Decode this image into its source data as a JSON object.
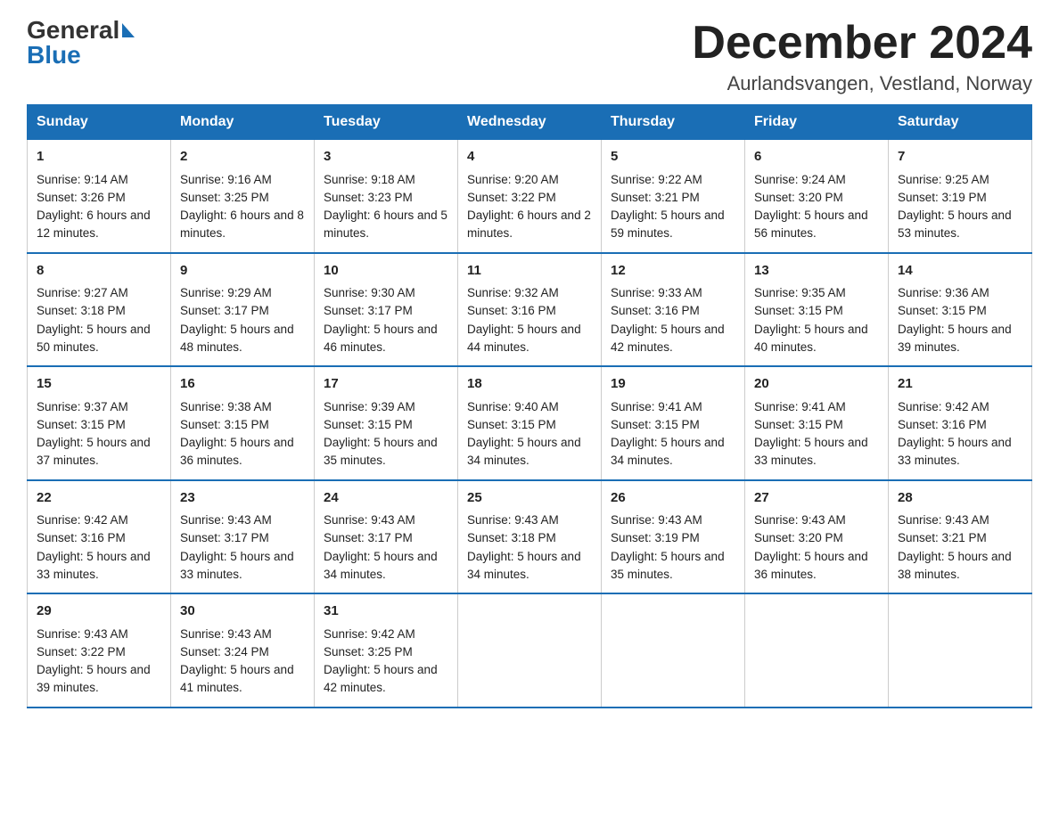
{
  "logo": {
    "general": "General",
    "blue": "Blue"
  },
  "title": "December 2024",
  "subtitle": "Aurlandsvangen, Vestland, Norway",
  "headers": [
    "Sunday",
    "Monday",
    "Tuesday",
    "Wednesday",
    "Thursday",
    "Friday",
    "Saturday"
  ],
  "weeks": [
    [
      {
        "day": "1",
        "sunrise": "9:14 AM",
        "sunset": "3:26 PM",
        "daylight": "6 hours and 12 minutes."
      },
      {
        "day": "2",
        "sunrise": "9:16 AM",
        "sunset": "3:25 PM",
        "daylight": "6 hours and 8 minutes."
      },
      {
        "day": "3",
        "sunrise": "9:18 AM",
        "sunset": "3:23 PM",
        "daylight": "6 hours and 5 minutes."
      },
      {
        "day": "4",
        "sunrise": "9:20 AM",
        "sunset": "3:22 PM",
        "daylight": "6 hours and 2 minutes."
      },
      {
        "day": "5",
        "sunrise": "9:22 AM",
        "sunset": "3:21 PM",
        "daylight": "5 hours and 59 minutes."
      },
      {
        "day": "6",
        "sunrise": "9:24 AM",
        "sunset": "3:20 PM",
        "daylight": "5 hours and 56 minutes."
      },
      {
        "day": "7",
        "sunrise": "9:25 AM",
        "sunset": "3:19 PM",
        "daylight": "5 hours and 53 minutes."
      }
    ],
    [
      {
        "day": "8",
        "sunrise": "9:27 AM",
        "sunset": "3:18 PM",
        "daylight": "5 hours and 50 minutes."
      },
      {
        "day": "9",
        "sunrise": "9:29 AM",
        "sunset": "3:17 PM",
        "daylight": "5 hours and 48 minutes."
      },
      {
        "day": "10",
        "sunrise": "9:30 AM",
        "sunset": "3:17 PM",
        "daylight": "5 hours and 46 minutes."
      },
      {
        "day": "11",
        "sunrise": "9:32 AM",
        "sunset": "3:16 PM",
        "daylight": "5 hours and 44 minutes."
      },
      {
        "day": "12",
        "sunrise": "9:33 AM",
        "sunset": "3:16 PM",
        "daylight": "5 hours and 42 minutes."
      },
      {
        "day": "13",
        "sunrise": "9:35 AM",
        "sunset": "3:15 PM",
        "daylight": "5 hours and 40 minutes."
      },
      {
        "day": "14",
        "sunrise": "9:36 AM",
        "sunset": "3:15 PM",
        "daylight": "5 hours and 39 minutes."
      }
    ],
    [
      {
        "day": "15",
        "sunrise": "9:37 AM",
        "sunset": "3:15 PM",
        "daylight": "5 hours and 37 minutes."
      },
      {
        "day": "16",
        "sunrise": "9:38 AM",
        "sunset": "3:15 PM",
        "daylight": "5 hours and 36 minutes."
      },
      {
        "day": "17",
        "sunrise": "9:39 AM",
        "sunset": "3:15 PM",
        "daylight": "5 hours and 35 minutes."
      },
      {
        "day": "18",
        "sunrise": "9:40 AM",
        "sunset": "3:15 PM",
        "daylight": "5 hours and 34 minutes."
      },
      {
        "day": "19",
        "sunrise": "9:41 AM",
        "sunset": "3:15 PM",
        "daylight": "5 hours and 34 minutes."
      },
      {
        "day": "20",
        "sunrise": "9:41 AM",
        "sunset": "3:15 PM",
        "daylight": "5 hours and 33 minutes."
      },
      {
        "day": "21",
        "sunrise": "9:42 AM",
        "sunset": "3:16 PM",
        "daylight": "5 hours and 33 minutes."
      }
    ],
    [
      {
        "day": "22",
        "sunrise": "9:42 AM",
        "sunset": "3:16 PM",
        "daylight": "5 hours and 33 minutes."
      },
      {
        "day": "23",
        "sunrise": "9:43 AM",
        "sunset": "3:17 PM",
        "daylight": "5 hours and 33 minutes."
      },
      {
        "day": "24",
        "sunrise": "9:43 AM",
        "sunset": "3:17 PM",
        "daylight": "5 hours and 34 minutes."
      },
      {
        "day": "25",
        "sunrise": "9:43 AM",
        "sunset": "3:18 PM",
        "daylight": "5 hours and 34 minutes."
      },
      {
        "day": "26",
        "sunrise": "9:43 AM",
        "sunset": "3:19 PM",
        "daylight": "5 hours and 35 minutes."
      },
      {
        "day": "27",
        "sunrise": "9:43 AM",
        "sunset": "3:20 PM",
        "daylight": "5 hours and 36 minutes."
      },
      {
        "day": "28",
        "sunrise": "9:43 AM",
        "sunset": "3:21 PM",
        "daylight": "5 hours and 38 minutes."
      }
    ],
    [
      {
        "day": "29",
        "sunrise": "9:43 AM",
        "sunset": "3:22 PM",
        "daylight": "5 hours and 39 minutes."
      },
      {
        "day": "30",
        "sunrise": "9:43 AM",
        "sunset": "3:24 PM",
        "daylight": "5 hours and 41 minutes."
      },
      {
        "day": "31",
        "sunrise": "9:42 AM",
        "sunset": "3:25 PM",
        "daylight": "5 hours and 42 minutes."
      },
      null,
      null,
      null,
      null
    ]
  ]
}
